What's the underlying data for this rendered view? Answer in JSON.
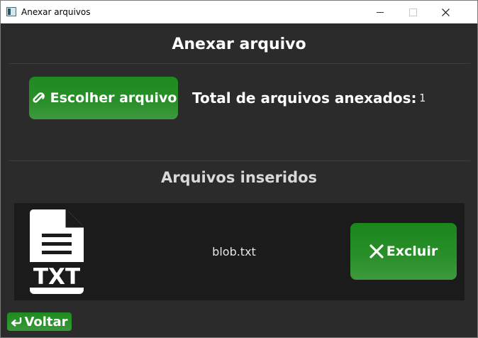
{
  "window": {
    "title": "Anexar arquivos"
  },
  "header": {
    "title": "Anexar arquivo"
  },
  "toolbar": {
    "choose_label": "Escolher arquivo",
    "choose_icon": "paperclip-icon",
    "total_label": "Total de arquivos anexados:",
    "total_value": "1"
  },
  "files_section": {
    "title": "Arquivos inseridos",
    "files": [
      {
        "name": "blob.txt",
        "icon": "txt-file-icon",
        "icon_text": "TXT",
        "delete_label": "Excluir",
        "delete_icon": "x-icon"
      }
    ]
  },
  "footer": {
    "back_label": "Voltar",
    "back_icon": "return-arrow-icon"
  },
  "colors": {
    "background": "#2b2b2b",
    "panel": "#1b1b1b",
    "accent_green": "#2a8f2a",
    "text": "#ffffff"
  }
}
